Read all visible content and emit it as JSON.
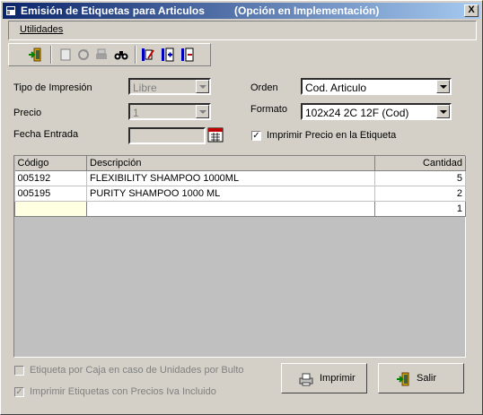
{
  "window": {
    "title": "Emisión de Etiquetas para Articulos",
    "subtitle": "(Opción en Implementación)",
    "close_glyph": "X"
  },
  "menu": {
    "utilidades": "Utilidades"
  },
  "toolbar": {
    "icons": [
      "exit-door-icon",
      "blank-page-icon",
      "refresh-icon",
      "print-icon",
      "binoculars-icon",
      "edit-grid-icon",
      "insert-row-icon",
      "delete-row-icon"
    ]
  },
  "form": {
    "tipo_label": "Tipo de Impresión",
    "tipo_value": "Libre",
    "precio_label": "Precio",
    "precio_value": "1",
    "fecha_label": "Fecha Entrada",
    "fecha_value": "",
    "orden_label": "Orden",
    "orden_value": "Cod. Articulo",
    "formato_label": "Formato",
    "formato_value": "102x24 2C 12F (Cod)",
    "imprimir_precio_label": "Imprimir Precio en la Etiqueta",
    "imprimir_precio_checked": true
  },
  "grid": {
    "headers": [
      "Código",
      "Descripción",
      "Cantidad"
    ],
    "rows": [
      {
        "codigo": "005192",
        "descripcion": "FLEXIBILITY SHAMPOO 1000ML",
        "cantidad": "5"
      },
      {
        "codigo": "005195",
        "descripcion": "PURITY SHAMPOO 1000 ML",
        "cantidad": "2"
      }
    ],
    "edit_row": {
      "codigo": "",
      "descripcion": "",
      "cantidad": "1"
    }
  },
  "options": {
    "etiqueta_caja_label": "Etiqueta por Caja en caso de Unidades por Bulto",
    "etiqueta_caja_checked": false,
    "iva_label": "Imprimir Etiquetas con Precios Iva Incluido",
    "iva_checked": true
  },
  "buttons": {
    "imprimir": "Imprimir",
    "salir": "Salir"
  },
  "colors": {
    "titlebar_start": "#0a246a",
    "titlebar_end": "#a6caf0",
    "face": "#d4d0c8"
  }
}
